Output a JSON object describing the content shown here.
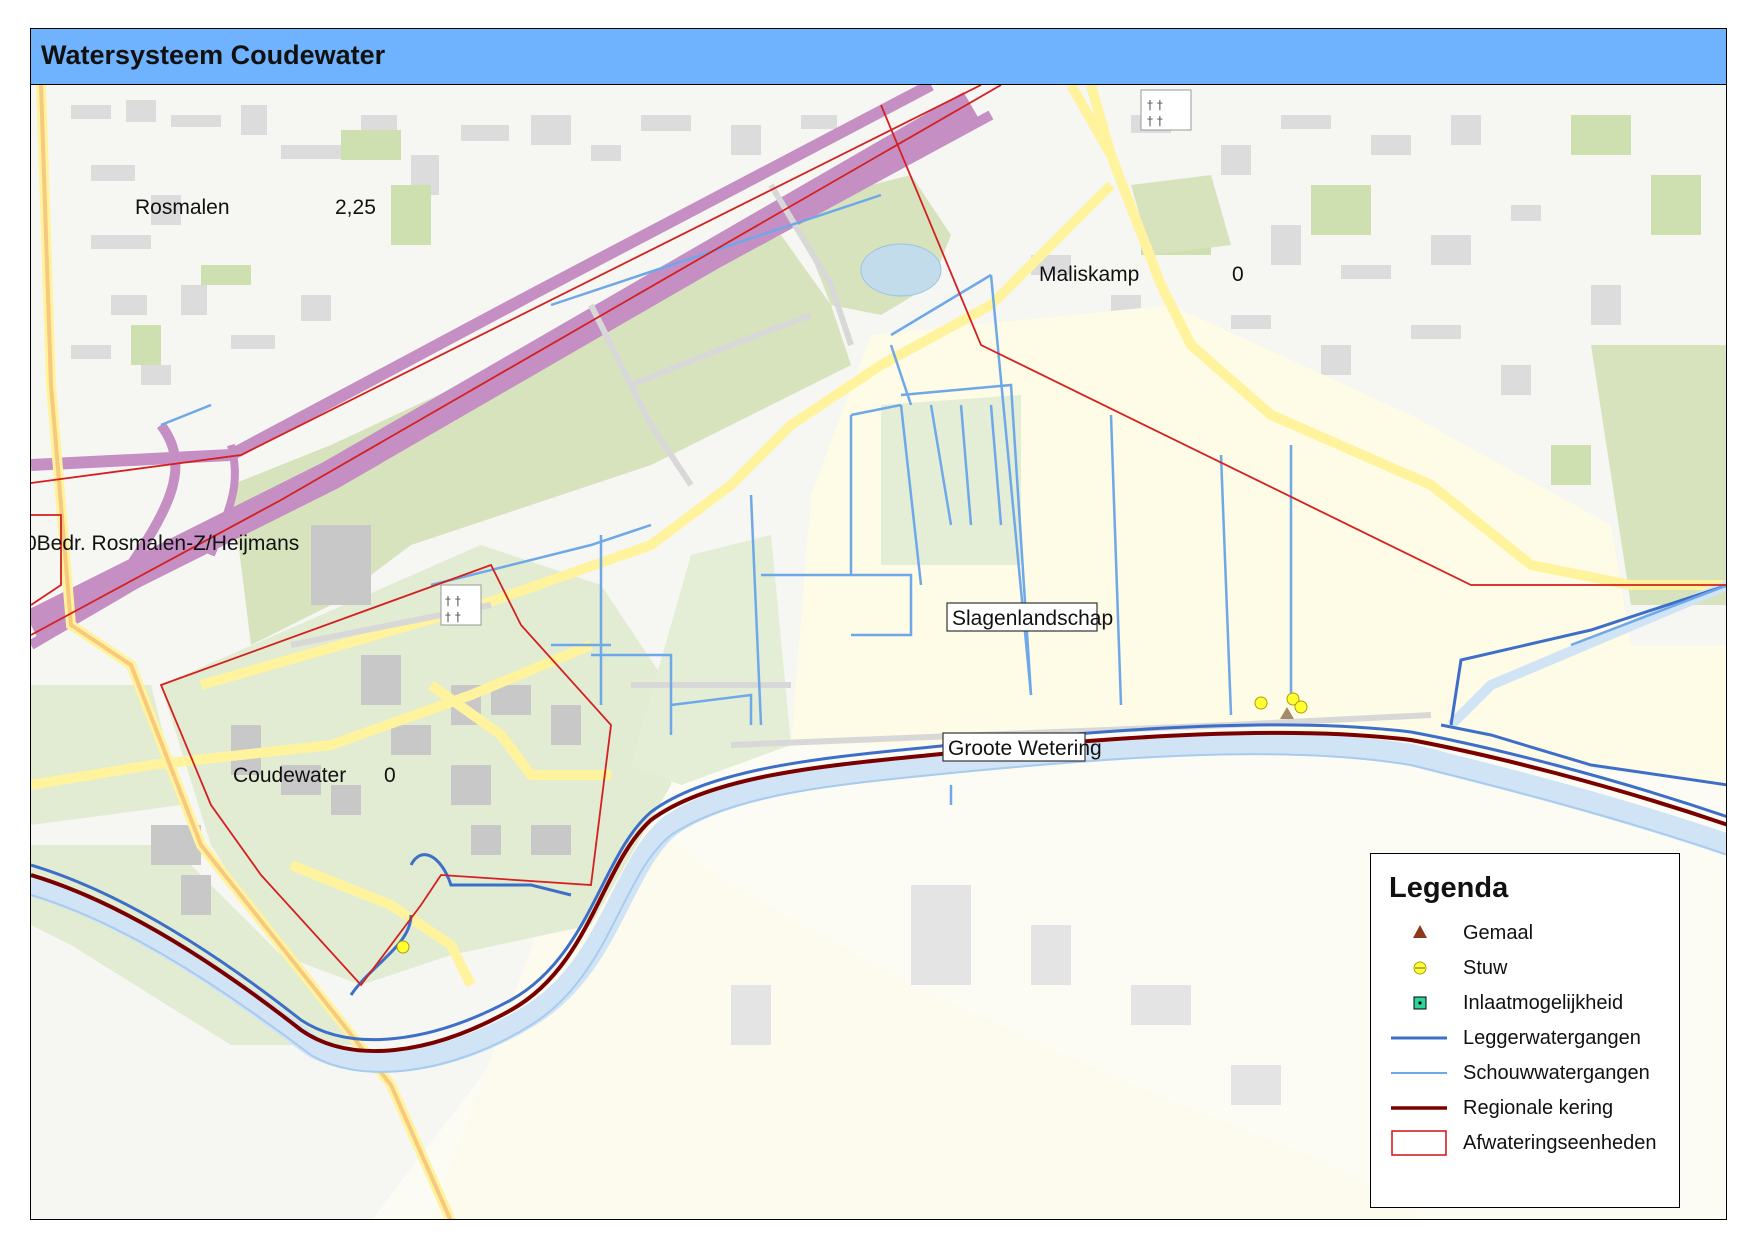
{
  "title": "Watersysteem Coudewater",
  "map_labels": {
    "rosmalen": {
      "name": "Rosmalen",
      "value": "2,25"
    },
    "maliskamp": {
      "name": "Maliskamp",
      "value": "0"
    },
    "coudewater": {
      "name": "Coudewater",
      "value": "0"
    },
    "bedr": "0Bedr. Rosmalen-Z/Heijmans",
    "slagenlandschap": "Slagenlandschap",
    "groote_wetering": "Groote Wetering"
  },
  "legend": {
    "title": "Legenda",
    "items": [
      {
        "label": "Gemaal",
        "icon": "triangle-icon",
        "color": "#8b3a1a"
      },
      {
        "label": "Stuw",
        "icon": "weir-icon",
        "color": "#ffff33"
      },
      {
        "label": "Inlaatmogelijkheid",
        "icon": "inlet-icon",
        "color": "#2fd49a"
      },
      {
        "label": "Leggerwatergangen",
        "icon": "line-icon",
        "color": "#3d6fc9"
      },
      {
        "label": "Schouwwatergangen",
        "icon": "line-icon",
        "color": "#6fa8e8"
      },
      {
        "label": "Regionale kering",
        "icon": "line-icon",
        "color": "#7a0000"
      },
      {
        "label": "Afwateringseenheden",
        "icon": "polygon-icon",
        "color": "#d42020"
      }
    ]
  }
}
